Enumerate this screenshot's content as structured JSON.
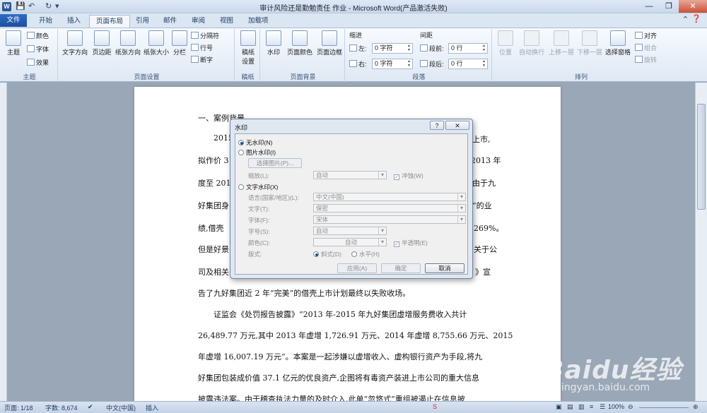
{
  "window": {
    "title": "审计风险还是勤勉责任 作业 - Microsoft Word(产品激活失败)",
    "app_icon": "W"
  },
  "tabs": [
    {
      "label": "文件"
    },
    {
      "label": "开始"
    },
    {
      "label": "插入"
    },
    {
      "label": "页面布局"
    },
    {
      "label": "引用"
    },
    {
      "label": "邮件"
    },
    {
      "label": "审阅"
    },
    {
      "label": "视图"
    },
    {
      "label": "加载项"
    }
  ],
  "ribbon": {
    "theme": {
      "label": "主题",
      "themes": "主题",
      "colors": "颜色",
      "fonts": "字体",
      "effects": "效果"
    },
    "page_setup": {
      "label": "页面设置",
      "text_direction": "文字方向",
      "margins": "页边距",
      "orientation": "纸张方向",
      "size": "纸张大小",
      "columns": "分栏",
      "breaks": "分隔符",
      "line_numbers": "行号",
      "hyphenation": "断字"
    },
    "draft": {
      "label": "稿纸",
      "draft_settings": "稿纸\n设置"
    },
    "page_bg": {
      "label": "页面背景",
      "watermark": "水印",
      "page_color": "页面颜色",
      "page_border": "页面边框"
    },
    "paragraph": {
      "label": "段落",
      "indent": "缩进",
      "spacing": "间距",
      "left": "左:",
      "right": "右:",
      "before": "段前:",
      "after": "段后:",
      "left_val": "0 字符",
      "right_val": "0 字符",
      "before_val": "0 行",
      "after_val": "0 行"
    },
    "arrange": {
      "label": "排列",
      "position": "位置",
      "wrap": "自动换行",
      "bring_forward": "上移一层",
      "send_backward": "下移一层",
      "selection_pane": "选择窗格",
      "align": "对齐",
      "group": "组合",
      "rotate": "旋转"
    }
  },
  "document": {
    "lines": [
      "一、案例背景",
      "2015",
      "上市,",
      "拟作价 3",
      "2013 年",
      "度至 201",
      "由于九",
      "好集团身",
      "”的业",
      "绩,借壳",
      "269%。",
      "但是好景",
      "关于公",
      "司及相关",
      "》宣",
      "告了九好集团近 2 年“完美”的借壳上市计划最终以失败收场。",
      "证监会《处罚报告披露》“2013 年-2015 年九好集团虚增服务费收入共计",
      "26,489.77 万元,其中 2013 年虚增 1,726.91 万元、2014 年虚增 8,755.66 万元、2015",
      "年虚增 16,007.19 万元”。本案是一起涉嫌以虚增收入、虚构银行资产为手段,将九",
      "好集团包装成价值 37.1 亿元的优良资产,企图将有毒资产装进上市公司的重大信息",
      "披露违法案。由于稽查执法力量的及时介入,此单“忽悠式”重组被遏止在信息披"
    ]
  },
  "dialog": {
    "title": "水印",
    "help": "?",
    "close": "✕",
    "no_watermark": "无水印(N)",
    "picture_watermark": "图片水印(I)",
    "select_picture": "选择图片(P)...",
    "scale_label": "缩放(L):",
    "scale_value": "自动",
    "washout": "冲蚀(W)",
    "text_watermark": "文字水印(X)",
    "language_label": "语言(国家/地区)(L):",
    "language_value": "中文(中国)",
    "text_label": "文字(T):",
    "text_value": "保密",
    "font_label": "字体(F):",
    "font_value": "宋体",
    "size_label": "字号(S):",
    "size_value": "自动",
    "color_label": "颜色(C):",
    "color_value": "自动",
    "semitransparent": "半透明(E)",
    "layout_label": "版式:",
    "diagonal": "斜式(D)",
    "horizontal": "水平(H)",
    "apply": "应用(A)",
    "ok": "确定",
    "cancel": "取消"
  },
  "statusbar": {
    "page": "页面: 1/18",
    "words": "字数: 8,674",
    "language": "中文(中国)",
    "mode": "插入",
    "zoom": "100%"
  },
  "watermark": {
    "brand": "Baidu经验",
    "url": "jingyan.baidu.com"
  }
}
